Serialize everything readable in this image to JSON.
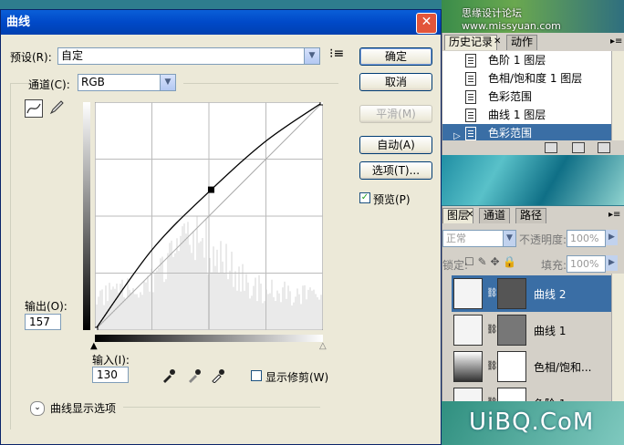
{
  "dialog": {
    "title": "曲线",
    "close_icon": "close-icon",
    "preset_label": "预设(R):",
    "preset_value": "自定",
    "channel_label": "通道(C):",
    "channel_value": "RGB",
    "output_label": "输出(O):",
    "output_value": "157",
    "input_label": "输入(I):",
    "input_value": "130",
    "show_clipping_label": "显示修剪(W)",
    "curve_options_label": "曲线显示选项",
    "buttons": {
      "ok": "确定",
      "cancel": "取消",
      "smooth": "平滑(M)",
      "auto": "自动(A)",
      "options": "选项(T)...",
      "preview": "预览(P)"
    },
    "preview_checked": true
  },
  "chart_data": {
    "type": "line",
    "title": "",
    "xlabel": "输入",
    "ylabel": "输出",
    "xlim": [
      0,
      255
    ],
    "ylim": [
      0,
      255
    ],
    "grid": true,
    "series": [
      {
        "values": [
          [
            0,
            0
          ],
          [
            64,
            90
          ],
          [
            130,
            157
          ],
          [
            192,
            212
          ],
          [
            255,
            255
          ]
        ]
      }
    ],
    "baseline": [
      [
        0,
        0
      ],
      [
        255,
        255
      ]
    ],
    "control_points": [
      [
        0,
        0
      ],
      [
        130,
        157
      ],
      [
        255,
        255
      ]
    ]
  },
  "history_panel": {
    "tabs": [
      "历史记录",
      "动作"
    ],
    "items": [
      "色阶 1 图层",
      "色相/饱和度 1 图层",
      "色彩范围",
      "曲线 1 图层",
      "色彩范围"
    ],
    "selected_index": 4
  },
  "layers_panel": {
    "tabs": [
      "图层",
      "通道",
      "路径"
    ],
    "blend_mode": "正常",
    "opacity_label": "不透明度:",
    "opacity_value": "100%",
    "lock_label": "锁定:",
    "fill_label": "填充:",
    "fill_value": "100%",
    "layers": [
      "曲线 2",
      "曲线 1",
      "色相/饱和...",
      "色阶 1"
    ],
    "selected_index": 0
  },
  "watermarks": {
    "top": "思缘设计论坛 www.missyuan.com",
    "bottom": "UiBQ.CoM"
  }
}
